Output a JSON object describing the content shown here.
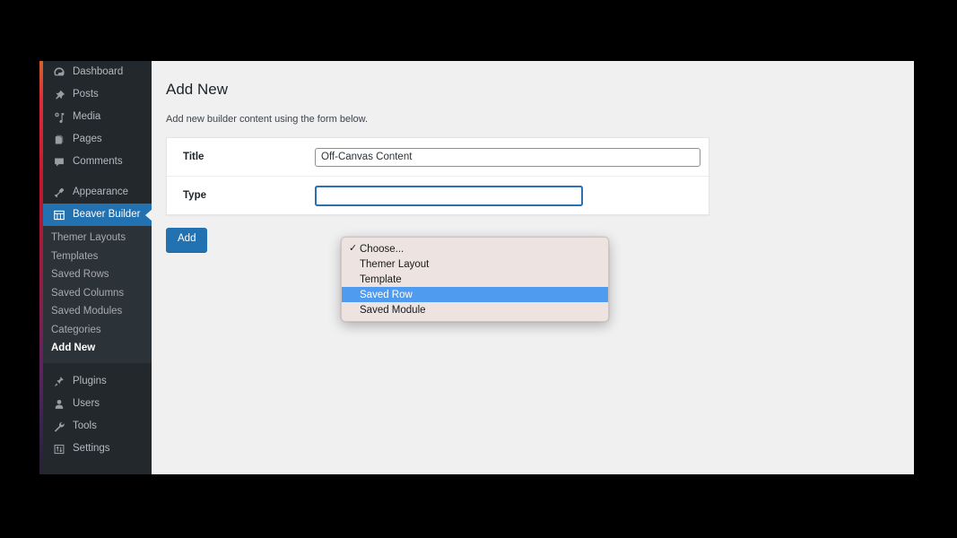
{
  "admin_sidebar": {
    "top_items": [
      {
        "label": "Dashboard",
        "icon": "dashboard-icon",
        "current": false
      },
      {
        "label": "Posts",
        "icon": "pin-icon",
        "current": false
      },
      {
        "label": "Media",
        "icon": "media-icon",
        "current": false
      },
      {
        "label": "Pages",
        "icon": "pages-icon",
        "current": false
      },
      {
        "label": "Comments",
        "icon": "comments-icon",
        "current": false
      }
    ],
    "appearance": {
      "label": "Appearance",
      "icon": "brush-icon"
    },
    "beaver_builder": {
      "label": "Beaver Builder",
      "icon": "layout-grid-icon",
      "current": true
    },
    "submenu_items": [
      {
        "label": "Themer Layouts",
        "current": false
      },
      {
        "label": "Templates",
        "current": false
      },
      {
        "label": "Saved Rows",
        "current": false
      },
      {
        "label": "Saved Columns",
        "current": false
      },
      {
        "label": "Saved Modules",
        "current": false
      },
      {
        "label": "Categories",
        "current": false
      },
      {
        "label": "Add New",
        "current": true
      }
    ],
    "bottom_items": [
      {
        "label": "Plugins",
        "icon": "plug-icon"
      },
      {
        "label": "Users",
        "icon": "user-icon"
      },
      {
        "label": "Tools",
        "icon": "wrench-icon"
      },
      {
        "label": "Settings",
        "icon": "sliders-icon"
      }
    ]
  },
  "main": {
    "page_title": "Add New",
    "page_description": "Add new builder content using the form below.",
    "form": {
      "title_label": "Title",
      "title_value": "Off-Canvas Content",
      "title_placeholder": "",
      "type_label": "Type",
      "type_selected": "Choose..."
    },
    "submit_label": "Add"
  },
  "select_popup": {
    "options": [
      {
        "label": "Choose...",
        "checked": true,
        "highlighted": false
      },
      {
        "label": "Themer Layout",
        "checked": false,
        "highlighted": false
      },
      {
        "label": "Template",
        "checked": false,
        "highlighted": false
      },
      {
        "label": "Saved Row",
        "checked": false,
        "highlighted": true
      },
      {
        "label": "Saved Module",
        "checked": false,
        "highlighted": false
      }
    ],
    "check_glyph": "✓"
  },
  "colors": {
    "wp_blue": "#2271b1",
    "admin_bg": "#23282d",
    "submenu_bg": "#2c3338",
    "content_bg": "#f0f0f1",
    "popup_bg": "#ede4e2",
    "popup_highlight": "#4f9bf0"
  }
}
